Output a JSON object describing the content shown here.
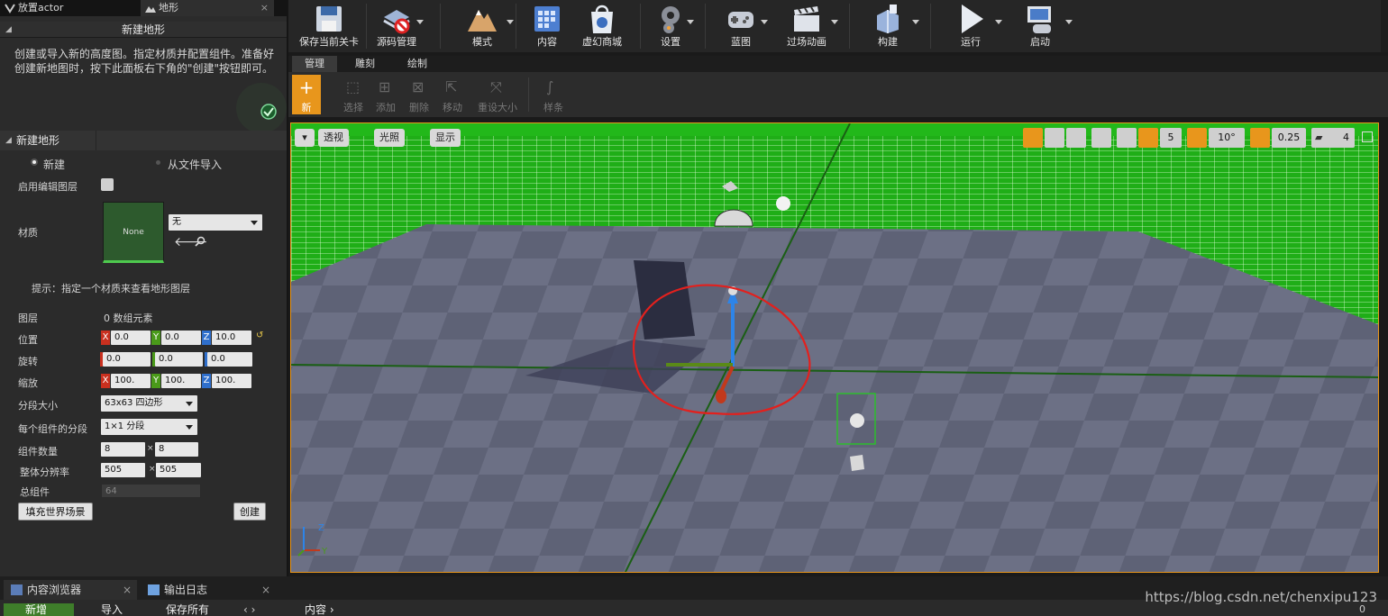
{
  "left_panel": {
    "tabs": [
      {
        "label": "放置actor",
        "active": false
      },
      {
        "label": "地形",
        "active": true
      }
    ],
    "header_new_landscape": "新建地形",
    "description": "创建或导入新的高度图。指定材质并配置组件。准备好创建新地图时，按下此面板右下角的\"创建\"按钮即可。",
    "section_title": "新建地形",
    "radio_new": "新建",
    "radio_import": "从文件导入",
    "enable_edit_layers": "启用编辑图层",
    "material_label": "材质",
    "material_thumb": "None",
    "material_value": "无",
    "hint": "提示：指定一个材质来查看地形图层",
    "layers_label": "图层",
    "layers_value": "0 数组元素",
    "location_label": "位置",
    "location": {
      "x": "0.0",
      "y": "0.0",
      "z": "10.0"
    },
    "rotation_label": "旋转",
    "rotation": {
      "x": "0.0",
      "y": "0.0",
      "z": "0.0"
    },
    "scale_label": "缩放",
    "scale": {
      "x": "100.",
      "y": "100.",
      "z": "100."
    },
    "section_size_label": "分段大小",
    "section_size_value": "63x63 四边形",
    "sections_per_component_label": "每个组件的分段",
    "sections_per_component_value": "1×1 分段",
    "component_count_label": "组件数量",
    "component_count": {
      "a": "8",
      "b": "8"
    },
    "overall_resolution_label": "整体分辨率",
    "overall_resolution": {
      "a": "505",
      "b": "505"
    },
    "times": "×",
    "total_components_label": "总组件",
    "total_components_value": "64",
    "fill_world_button": "填充世界场景",
    "create_button": "创建"
  },
  "toolbar": {
    "buttons": [
      {
        "label": "保存当前关卡",
        "icon": "save-icon"
      },
      {
        "label": "源码管理",
        "icon": "source-control-icon"
      },
      {
        "label": "模式",
        "icon": "modes-icon"
      },
      {
        "label": "内容",
        "icon": "content-icon"
      },
      {
        "label": "虚幻商城",
        "icon": "marketplace-icon"
      },
      {
        "label": "设置",
        "icon": "settings-icon"
      },
      {
        "label": "蓝图",
        "icon": "blueprint-icon"
      },
      {
        "label": "过场动画",
        "icon": "cinematics-icon"
      },
      {
        "label": "构建",
        "icon": "build-icon"
      },
      {
        "label": "运行",
        "icon": "play-icon"
      },
      {
        "label": "启动",
        "icon": "launch-icon"
      }
    ]
  },
  "mode_tabs": [
    {
      "label": "管理",
      "active": true
    },
    {
      "label": "雕刻",
      "active": false
    },
    {
      "label": "绘制",
      "active": false
    }
  ],
  "tools": [
    {
      "label": "新",
      "active": true
    },
    {
      "label": "选择",
      "active": false
    },
    {
      "label": "添加",
      "active": false
    },
    {
      "label": "删除",
      "active": false
    },
    {
      "label": "移动",
      "active": false
    },
    {
      "label": "重设大小",
      "active": false
    },
    {
      "label": "样条",
      "active": false
    }
  ],
  "viewport": {
    "perspective_label": "透视",
    "lit_label": "光照",
    "show_label": "显示",
    "grid_snap_value": "5",
    "rotation_snap_value": "10°",
    "scale_snap_value": "0.25",
    "camera_speed_value": "4",
    "axis_z": "Z",
    "axis_y": "Y",
    "colors": {
      "grid_green": "#22b81a",
      "floor": "#6f7387",
      "floor_alt": "#5c6075",
      "highlight": "#e8961c"
    }
  },
  "bottom": {
    "tabs": [
      {
        "label": "内容浏览器",
        "active": true
      },
      {
        "label": "输出日志",
        "active": false
      }
    ],
    "add_new": "新增",
    "import": "导入",
    "save_all": "保存所有",
    "path": "内容",
    "count": "0"
  },
  "watermark": "https://blog.csdn.net/chenxipu123"
}
